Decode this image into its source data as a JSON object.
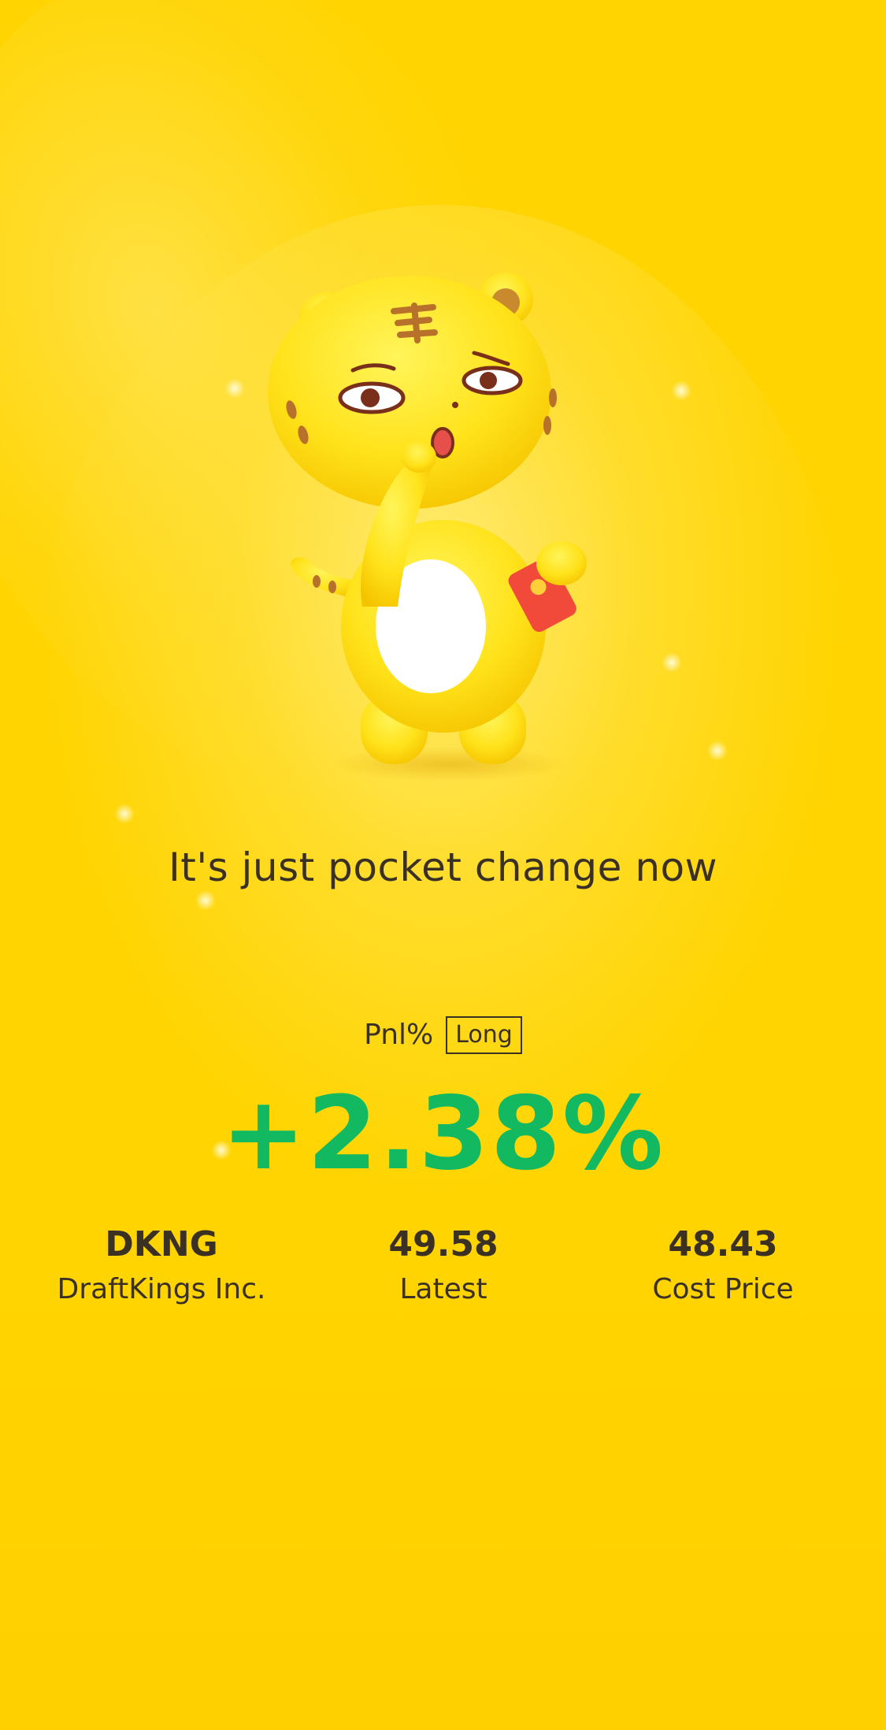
{
  "headline": "It's just pocket change now",
  "pnl": {
    "label": "Pnl%",
    "position_type": "Long",
    "value": "+2.38%"
  },
  "stats": [
    {
      "value": "DKNG",
      "label": "DraftKings Inc."
    },
    {
      "value": "49.58",
      "label": "Latest"
    },
    {
      "value": "48.43",
      "label": "Cost Price"
    }
  ],
  "colors": {
    "background": "#ffd400",
    "gain": "#12b960",
    "text": "#3a3124"
  },
  "illustration": "tiger-mascot-holding-red-envelope"
}
